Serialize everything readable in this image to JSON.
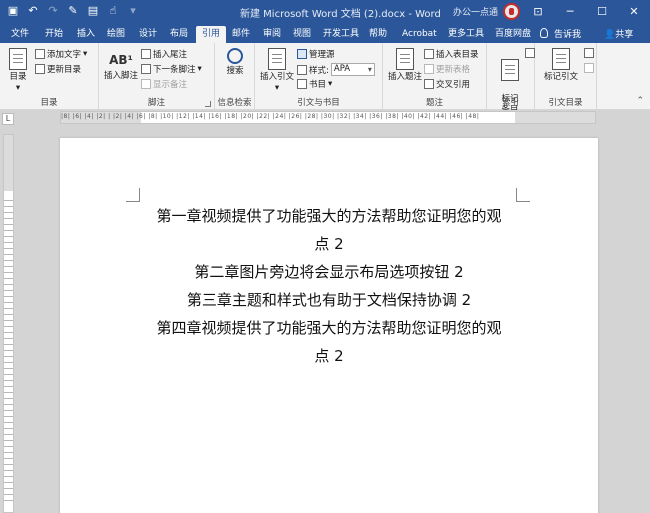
{
  "window": {
    "title": "新建 Microsoft Word 文档 (2).docx - Word",
    "account": "办公一点通",
    "controls": [
      "ribbon-display-icon",
      "minimize-icon",
      "maximize-icon",
      "close-icon"
    ]
  },
  "qat": [
    "save-icon",
    "undo-icon",
    "redo-icon",
    "format-painter-icon",
    "print-preview-icon",
    "touch-mode-icon",
    "customize-icon"
  ],
  "tabs": [
    "文件",
    "开始",
    "插入",
    "绘图",
    "设计",
    "布局",
    "引用",
    "邮件",
    "审阅",
    "视图",
    "开发工具",
    "帮助",
    "Acrobat",
    "更多工具",
    "百度网盘"
  ],
  "active_tab": "引用",
  "tell_me": "告诉我",
  "share": "共享",
  "ribbon": {
    "toc_group": {
      "label": "目录",
      "toc_button": "目录",
      "add_text": "添加文字",
      "update_toc": "更新目录"
    },
    "footnote_group": {
      "label": "脚注",
      "insert_footnote": "插入脚注",
      "insert_endnote": "插入尾注",
      "next_footnote": "下一条脚注",
      "show_notes": "显示备注",
      "ab_badge": "AB¹"
    },
    "research_group": {
      "label": "信息检索",
      "search": "搜索"
    },
    "citation_group": {
      "label": "引文与书目",
      "insert_citation": "插入引文",
      "manage_sources": "管理源",
      "style_label": "样式:",
      "style_value": "APA",
      "bibliography": "书目"
    },
    "caption_group": {
      "label": "题注",
      "insert_caption": "插入题注",
      "insert_table_of_figures": "插入表目录",
      "update_table": "更新表格",
      "cross_reference": "交叉引用"
    },
    "index_group": {
      "label": "索引",
      "mark_entry": "标记\n条目"
    },
    "authorities_group": {
      "label": "引文目录",
      "mark_citation": "标记引文"
    }
  },
  "ruler": {
    "corner": "L",
    "ticks": "|8| |6| |4| |2| | |2| |4| |6| |8| |10| |12| |14| |16| |18| |20| |22| |24| |26| |28| |30| |32| |34| |36| |38| |40| |42| |44| |46| |48|"
  },
  "document": {
    "toc_lines": [
      "第一章视频提供了功能强大的方法帮助您证明您的观",
      "点 2",
      "第二章图片旁边将会显示布局选项按钮 2",
      "第三章主题和样式也有助于文档保持协调 2",
      "第四章视频提供了功能强大的方法帮助您证明您的观",
      "点 2"
    ]
  }
}
